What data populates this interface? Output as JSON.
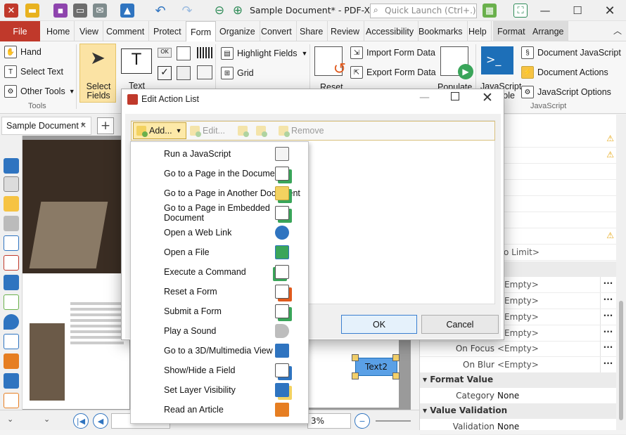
{
  "titlebar": {
    "document_title": "Sample Document* - PDF-XCh...",
    "quick_launch_placeholder": "Quick Launch (Ctrl+.)"
  },
  "menu": {
    "file": "File",
    "items": [
      "Home",
      "View",
      "Comment",
      "Protect",
      "Form",
      "Organize",
      "Convert",
      "Share",
      "Review",
      "Accessibility",
      "Bookmarks",
      "Help",
      "Format",
      "Arrange"
    ]
  },
  "ribbon": {
    "hand": "Hand",
    "select_text": "Select Text",
    "other_tools": "Other Tools",
    "tools_group": "Tools",
    "select_fields": "Select Fields",
    "text": "Text",
    "highlight_fields": "Highlight Fields",
    "grid": "Grid",
    "reset": "Reset",
    "import_form_data": "Import Form Data",
    "export_form_data": "Export Form Data",
    "populate": "Populate",
    "javascript_console": "JavaScript Console",
    "document_javascript": "Document JavaScript",
    "document_actions": "Document Actions",
    "javascript_options": "JavaScript Options",
    "javascript_group": "JavaScript"
  },
  "doc_tab": {
    "label": "Sample Document *",
    "new_tab": "+"
  },
  "dialog": {
    "title": "Edit Action List",
    "toolbar": {
      "add": "Add...",
      "edit": "Edit...",
      "remove": "Remove"
    },
    "ok": "OK",
    "cancel": "Cancel"
  },
  "add_menu": [
    {
      "label": "Run a JavaScript",
      "icon": "javascript-icon"
    },
    {
      "label": "Go to a Page in the Document",
      "icon": "goto-page-icon"
    },
    {
      "label": "Go to a Page in Another Document",
      "icon": "goto-other-doc-icon"
    },
    {
      "label": "Go to a Page in Embedded Document",
      "icon": "goto-embedded-doc-icon"
    },
    {
      "label": "Open a Web Link",
      "icon": "web-link-icon"
    },
    {
      "label": "Open a File",
      "icon": "open-file-icon"
    },
    {
      "label": "Execute a Command",
      "icon": "command-icon"
    },
    {
      "label": "Reset a Form",
      "icon": "reset-form-icon"
    },
    {
      "label": "Submit a Form",
      "icon": "submit-form-icon"
    },
    {
      "label": "Play a Sound",
      "icon": "sound-icon"
    },
    {
      "label": "Go to a 3D/Multimedia View",
      "icon": "3d-view-icon"
    },
    {
      "label": "Show/Hide a Field",
      "icon": "show-hide-icon"
    },
    {
      "label": "Set Layer Visibility",
      "icon": "layer-icon"
    },
    {
      "label": "Read an Article",
      "icon": "article-icon"
    }
  ],
  "properties": {
    "partial_values": [
      "s",
      "s",
      "No Limit>"
    ],
    "rows": [
      {
        "key": "",
        "value": "<Empty>"
      },
      {
        "key": "",
        "value": "<Empty>"
      },
      {
        "key": "",
        "value": "<Empty>"
      },
      {
        "key": "",
        "value": "<Empty>"
      },
      {
        "key": "On Focus",
        "value": "<Empty>"
      },
      {
        "key": "On Blur",
        "value": "<Empty>"
      }
    ],
    "format_section": "Format Value",
    "category_key": "Category",
    "category_value": "None",
    "validation_section": "Value Validation",
    "validation_key": "Validation",
    "validation_value": "None"
  },
  "statusbar": {
    "zoom": "3%"
  },
  "canvas": {
    "field_label": "Text2"
  }
}
